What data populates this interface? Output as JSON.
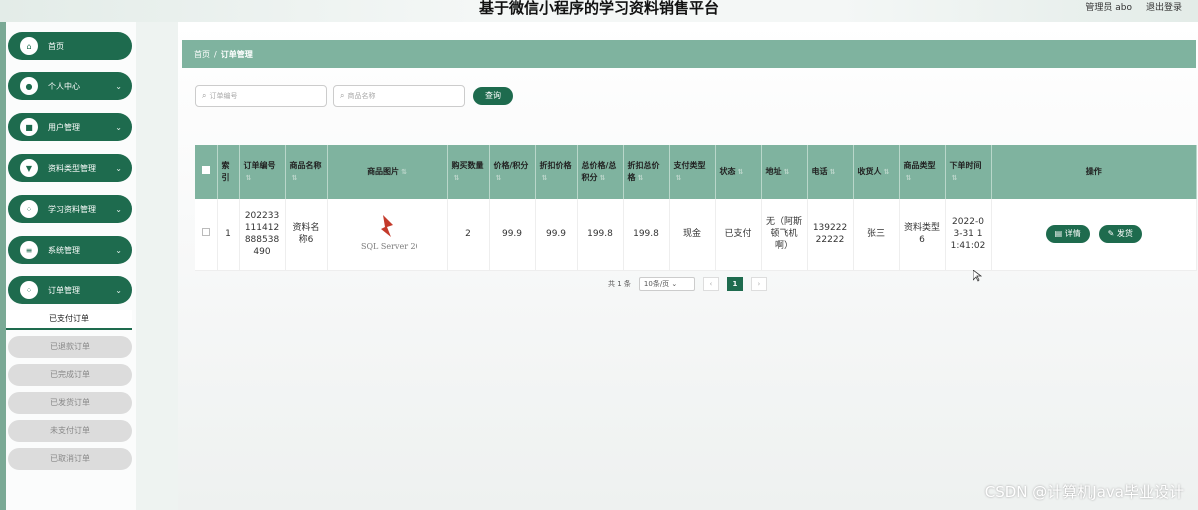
{
  "header": {
    "title": "基于微信小程序的学习资料销售平台",
    "user_label": "管理员 abo",
    "logout_label": "退出登录"
  },
  "sidebar": {
    "items": [
      {
        "label": "首页",
        "icon": "home-icon",
        "chevron": false
      },
      {
        "label": "个人中心",
        "icon": "person-icon",
        "chevron": true
      },
      {
        "label": "用户管理",
        "icon": "user-icon",
        "chevron": true
      },
      {
        "label": "资料类型管理",
        "icon": "tag-icon",
        "chevron": true
      },
      {
        "label": "学习资料管理",
        "icon": "grid-icon",
        "chevron": true
      },
      {
        "label": "系统管理",
        "icon": "menu-icon",
        "chevron": true
      },
      {
        "label": "订单管理",
        "icon": "grid-icon",
        "chevron": true
      }
    ],
    "submenu": [
      "已支付订单",
      "已退款订单",
      "已完成订单",
      "已发货订单",
      "未支付订单",
      "已取消订单"
    ],
    "chevron_glyph": "⌄"
  },
  "breadcrumb": {
    "home": "首页",
    "sep": "/",
    "current": "订单管理"
  },
  "search": {
    "order_no_placeholder": "订单编号",
    "product_name_placeholder": "商品名称",
    "query_label": "查询"
  },
  "table": {
    "headers": [
      "索引",
      "订单编号",
      "商品名称",
      "商品图片",
      "购买数量",
      "价格/积分",
      "折扣价格",
      "总价格/总积分",
      "折扣总价格",
      "支付类型",
      "状态",
      "地址",
      "电话",
      "收货人",
      "商品类型",
      "下单时间",
      "操作"
    ],
    "rows": [
      {
        "index": "1",
        "order_no": "202233111412888538490",
        "product_name": "资料名称6",
        "image_label": "SQL Server 2012",
        "qty": "2",
        "price": "99.9",
        "discount_price": "99.9",
        "total": "199.8",
        "discount_total": "199.8",
        "pay_type": "现金",
        "status": "已支付",
        "address": "无（阿斯顿飞机啊）",
        "phone": "13922222222",
        "receiver": "张三",
        "category": "资料类型6",
        "time": "2022-03-31 11:41:02",
        "detail_label": "详情",
        "ship_label": "发货"
      }
    ]
  },
  "pagination": {
    "total": "共 1 条",
    "page_size": "10条/页",
    "current_page": "1"
  },
  "watermark": "CSDN @计算机Java毕业设计",
  "colors": {
    "primary": "#1e6b4e",
    "header_bar": "#7fb39f"
  }
}
